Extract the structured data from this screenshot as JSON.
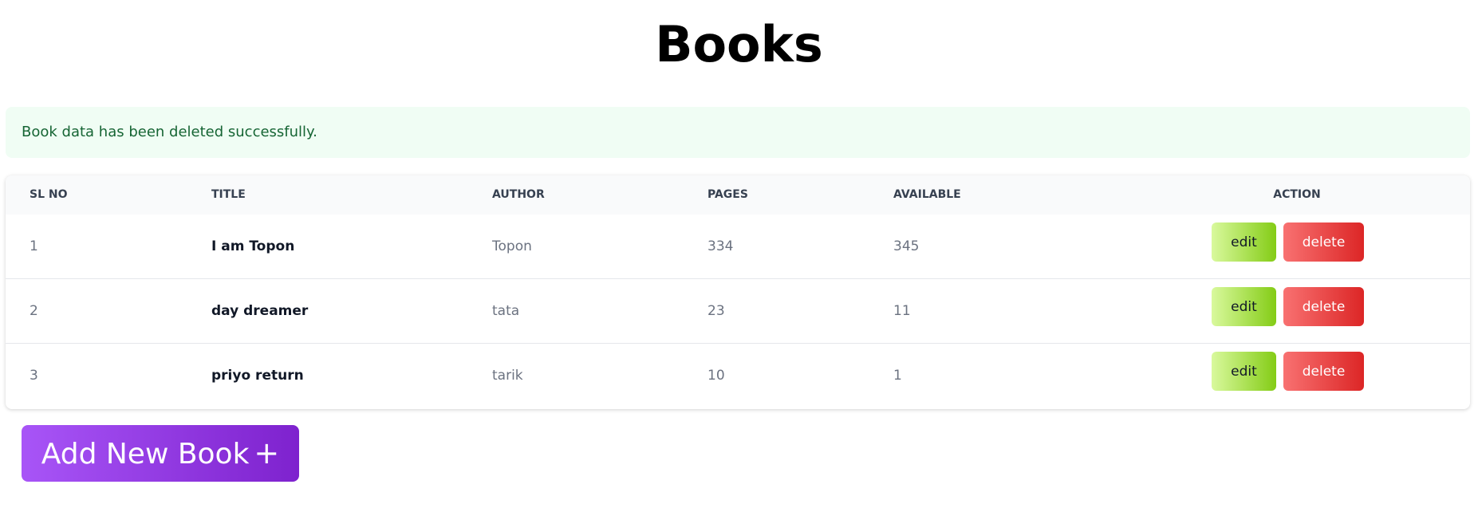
{
  "page": {
    "title": "Books"
  },
  "alert": {
    "message": "Book data has been deleted successfully."
  },
  "table": {
    "headers": {
      "sl_no": "SL NO",
      "title": "TITLE",
      "author": "AUTHOR",
      "pages": "PAGES",
      "available": "AVAILABLE",
      "action": "ACTION"
    },
    "rows": [
      {
        "sl_no": "1",
        "title": "I am Topon",
        "author": "Topon",
        "pages": "334",
        "available": "345",
        "edit_label": "edit",
        "delete_label": "delete"
      },
      {
        "sl_no": "2",
        "title": "day dreamer",
        "author": "tata",
        "pages": "23",
        "available": "11",
        "edit_label": "edit",
        "delete_label": "delete"
      },
      {
        "sl_no": "3",
        "title": "priyo return",
        "author": "tarik",
        "pages": "10",
        "available": "1",
        "edit_label": "edit",
        "delete_label": "delete"
      }
    ]
  },
  "add_button": {
    "label": "Add New Book",
    "icon": "plus-icon",
    "icon_glyph": "+"
  },
  "colors": {
    "alert_bg": "#f0fdf4",
    "alert_text": "#166534",
    "edit_gradient": [
      "#d9f99d",
      "#84cc16"
    ],
    "delete_gradient": [
      "#f87171",
      "#dc2626"
    ],
    "add_gradient": [
      "#a855f7",
      "#7e22ce"
    ]
  }
}
